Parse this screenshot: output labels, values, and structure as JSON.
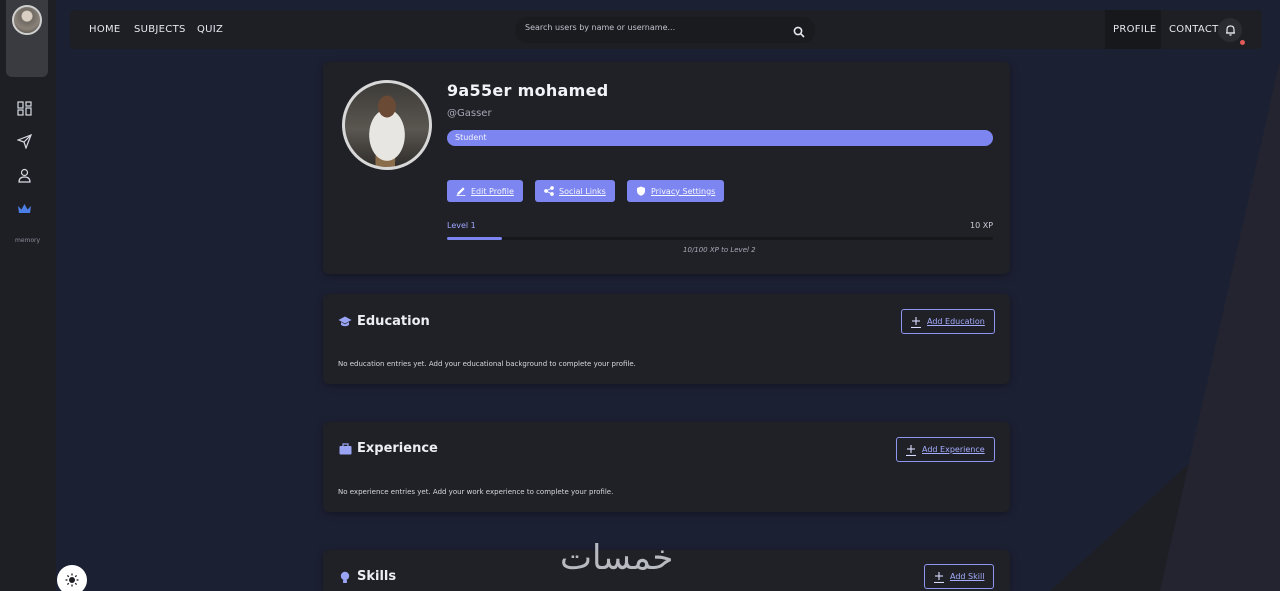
{
  "nav": {
    "home": "HOME",
    "subjects": "SUBJECTS",
    "quiz": "QUIZ",
    "search_placeholder": "Search users by name or username...",
    "profile": "PROFILE",
    "contact": "CONTACT"
  },
  "sidebar": {
    "items": [
      {
        "icon": "dashboard-icon"
      },
      {
        "icon": "send-icon"
      },
      {
        "icon": "user-icon"
      },
      {
        "icon": "crown-icon"
      }
    ],
    "label": "memory"
  },
  "profile": {
    "name": "9a55er mohamed",
    "username": "@Gasser",
    "role": "Student",
    "buttons": {
      "edit": "Edit Profile",
      "social": "Social Links",
      "privacy": "Privacy Settings"
    },
    "level": "Level 1",
    "xp": "10 XP",
    "xp_progress": 0.1,
    "xp_next": "10/100 XP to Level 2"
  },
  "education": {
    "title": "Education",
    "add_label": "Add Education",
    "empty": "No education entries yet. Add your educational background to complete your profile."
  },
  "experience": {
    "title": "Experience",
    "add_label": "Add Experience",
    "empty": "No experience entries yet. Add your work experience to complete your profile."
  },
  "skills": {
    "title": "Skills",
    "add_label": "Add Skill"
  },
  "colors": {
    "accent": "#7d86f0",
    "card": "#202126",
    "background": "#1c2033"
  },
  "watermark": "خمسات"
}
